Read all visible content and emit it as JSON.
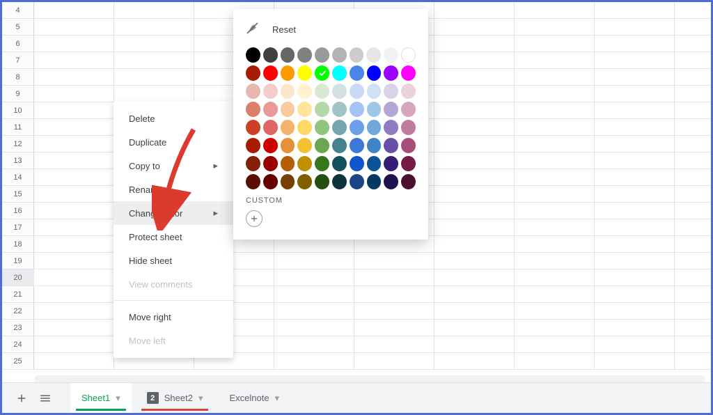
{
  "rows": {
    "start": 4,
    "end": 25,
    "selected": 20
  },
  "context_menu": {
    "items": [
      {
        "label": "Delete"
      },
      {
        "label": "Duplicate"
      },
      {
        "label": "Copy to",
        "submenu": true
      },
      {
        "label": "Rename"
      },
      {
        "label": "Change color",
        "submenu": true,
        "active": true
      },
      {
        "label": "Protect sheet"
      },
      {
        "label": "Hide sheet"
      },
      {
        "label": "View comments",
        "disabled": true
      },
      {
        "divider": true
      },
      {
        "label": "Move right"
      },
      {
        "label": "Move left",
        "disabled": true
      }
    ]
  },
  "color_picker": {
    "reset_label": "Reset",
    "custom_label": "CUSTOM",
    "selected": {
      "row": 1,
      "col": 4
    },
    "grid": [
      [
        "#000000",
        "#404040",
        "#666666",
        "#808080",
        "#999999",
        "#b3b3b3",
        "#cccccc",
        "#e6e6e6",
        "#f2f2f2",
        "#ffffff"
      ],
      [
        "#a61c00",
        "#ff0000",
        "#ff9900",
        "#ffff00",
        "#00ff00",
        "#00ffff",
        "#4a86e8",
        "#0000ff",
        "#9900ff",
        "#ff00ff"
      ],
      [
        "#e6b8af",
        "#f4cccc",
        "#fce5cd",
        "#fff2cc",
        "#d9ead3",
        "#d0e0e3",
        "#c9daf8",
        "#cfe2f3",
        "#d9d2e9",
        "#ead1dc"
      ],
      [
        "#dd7e6b",
        "#ea9999",
        "#f9cb9c",
        "#ffe599",
        "#b6d7a8",
        "#a2c4c9",
        "#a4c2f4",
        "#9fc5e8",
        "#b4a7d6",
        "#d5a6bd"
      ],
      [
        "#cc4125",
        "#e06666",
        "#f6b26b",
        "#ffd966",
        "#93c47d",
        "#76a5af",
        "#6d9eeb",
        "#6fa8dc",
        "#8e7cc3",
        "#c27ba0"
      ],
      [
        "#a61c00",
        "#cc0000",
        "#e69138",
        "#f1c232",
        "#6aa84f",
        "#45818e",
        "#3c78d8",
        "#3d85c6",
        "#674ea7",
        "#a64d79"
      ],
      [
        "#85200c",
        "#990000",
        "#b45f06",
        "#bf9000",
        "#38761d",
        "#134f5c",
        "#1155cc",
        "#0b5394",
        "#351c75",
        "#741b47"
      ],
      [
        "#5b0f00",
        "#660000",
        "#783f04",
        "#7f6000",
        "#274e13",
        "#0c343d",
        "#1c4587",
        "#073763",
        "#20124d",
        "#4c1130"
      ]
    ]
  },
  "sheet_tabs": {
    "add_icon": "plus-icon",
    "list_icon": "all-sheets-icon",
    "tabs": [
      {
        "label": "Sheet1",
        "active": true,
        "color": "#0f9d58"
      },
      {
        "label": "Sheet2",
        "badge": "2",
        "color": "#db4437"
      },
      {
        "label": "Excelnote"
      }
    ]
  }
}
